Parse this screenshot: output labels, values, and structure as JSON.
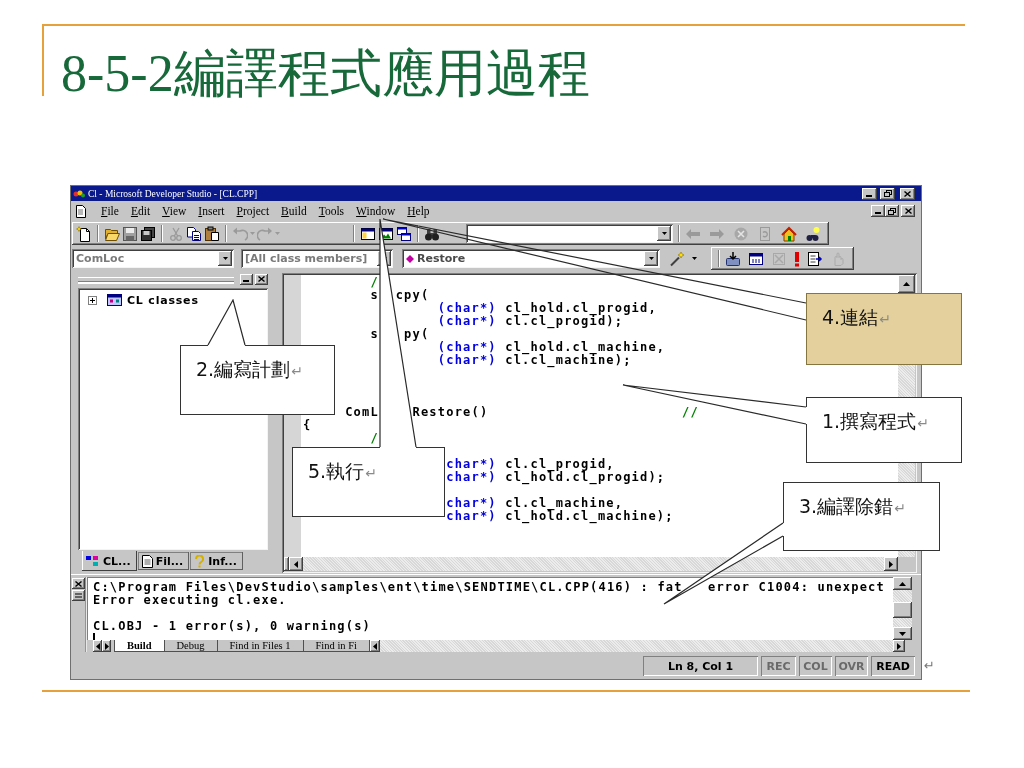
{
  "slide": {
    "title": "8-5-2編譯程式應用過程"
  },
  "window": {
    "title": "Cl - Microsoft Developer Studio - [CL.CPP]"
  },
  "menu": [
    "File",
    "Edit",
    "View",
    "Insert",
    "Project",
    "Build",
    "Tools",
    "Window",
    "Help"
  ],
  "wizard_bar": {
    "class": "ComLoc",
    "filter": "[All class members]",
    "member": "Restore"
  },
  "workspace": {
    "tree": [
      {
        "label": "CL classes",
        "expanded": false
      }
    ],
    "tabs": [
      {
        "label": "CL...",
        "selected": true
      },
      {
        "label": "Fil...",
        "selected": false
      },
      {
        "label": "Inf...",
        "selected": false
      }
    ]
  },
  "editor": {
    "lines": [
      {
        "segments": [
          {
            "text": "        /",
            "kind": "comment"
          }
        ]
      },
      {
        "segments": [
          {
            "text": "        s  cpy(",
            "kind": "plain"
          }
        ]
      },
      {
        "segments": [
          {
            "text": "                (char*)",
            "kind": "keyword"
          },
          {
            "text": " cl_hold.cl_progid,",
            "kind": "plain"
          }
        ]
      },
      {
        "segments": [
          {
            "text": "                (char*)",
            "kind": "keyword"
          },
          {
            "text": " cl.cl_progid);",
            "kind": "plain"
          }
        ]
      },
      {
        "segments": [
          {
            "text": "        s   py(",
            "kind": "plain"
          }
        ]
      },
      {
        "segments": [
          {
            "text": "                (char*)",
            "kind": "keyword"
          },
          {
            "text": " cl_hold.cl_machine,",
            "kind": "plain"
          }
        ]
      },
      {
        "segments": [
          {
            "text": "                (char*)",
            "kind": "keyword"
          },
          {
            "text": " cl.cl_machine);",
            "kind": "plain"
          }
        ]
      },
      {
        "segments": [
          {
            "text": "     ComL    Restore()",
            "kind": "plain"
          },
          {
            "text": "                       //",
            "kind": "comment"
          }
        ]
      },
      {
        "segments": [
          {
            "text": "{",
            "kind": "plain"
          }
        ]
      },
      {
        "segments": [
          {
            "text": "        /",
            "kind": "comment"
          }
        ]
      },
      {
        "segments": [
          {
            "text": "                 char*)",
            "kind": "keyword"
          },
          {
            "text": " cl.cl_progid,",
            "kind": "plain"
          }
        ]
      },
      {
        "segments": [
          {
            "text": "                 char*)",
            "kind": "keyword"
          },
          {
            "text": " cl_hold.cl_progid);",
            "kind": "plain"
          }
        ]
      },
      {
        "segments": [
          {
            "text": "                 char*)",
            "kind": "keyword"
          },
          {
            "text": " cl.cl_machine,",
            "kind": "plain"
          }
        ]
      },
      {
        "segments": [
          {
            "text": "                 char*)",
            "kind": "keyword"
          },
          {
            "text": " cl_hold.cl_machine);",
            "kind": "plain"
          }
        ]
      }
    ]
  },
  "output": {
    "lines": [
      "C:\\Program Files\\DevStudio\\samples\\ent\\time\\SENDTIME\\CL.CPP(416) : fat   error C1004: unexpect",
      "Error executing cl.exe.",
      "CL.OBJ - 1 error(s), 0 warning(s)"
    ],
    "tabs": [
      {
        "label": "Build",
        "selected": true
      },
      {
        "label": "Debug",
        "selected": false
      },
      {
        "label": "Find in Files 1",
        "selected": false
      },
      {
        "label": "Find in Fi",
        "selected": false
      }
    ]
  },
  "status_bar": {
    "position": "Ln 8, Col 1",
    "indicators": [
      {
        "label": "REC",
        "disabled": true
      },
      {
        "label": "COL",
        "disabled": true
      },
      {
        "label": "OVR",
        "disabled": true
      },
      {
        "label": "READ",
        "disabled": false
      }
    ],
    "mark": "↵"
  },
  "callouts": [
    {
      "text": "4.連結",
      "mark": "↵",
      "highlighted": true
    },
    {
      "text": "2.編寫計劃",
      "mark": "↵",
      "highlighted": false
    },
    {
      "text": "1.撰寫程式",
      "mark": "↵",
      "highlighted": false
    },
    {
      "text": "5.執行",
      "mark": "↵",
      "highlighted": false
    },
    {
      "text": "3.編譯除錯",
      "mark": "↵",
      "highlighted": false
    }
  ]
}
